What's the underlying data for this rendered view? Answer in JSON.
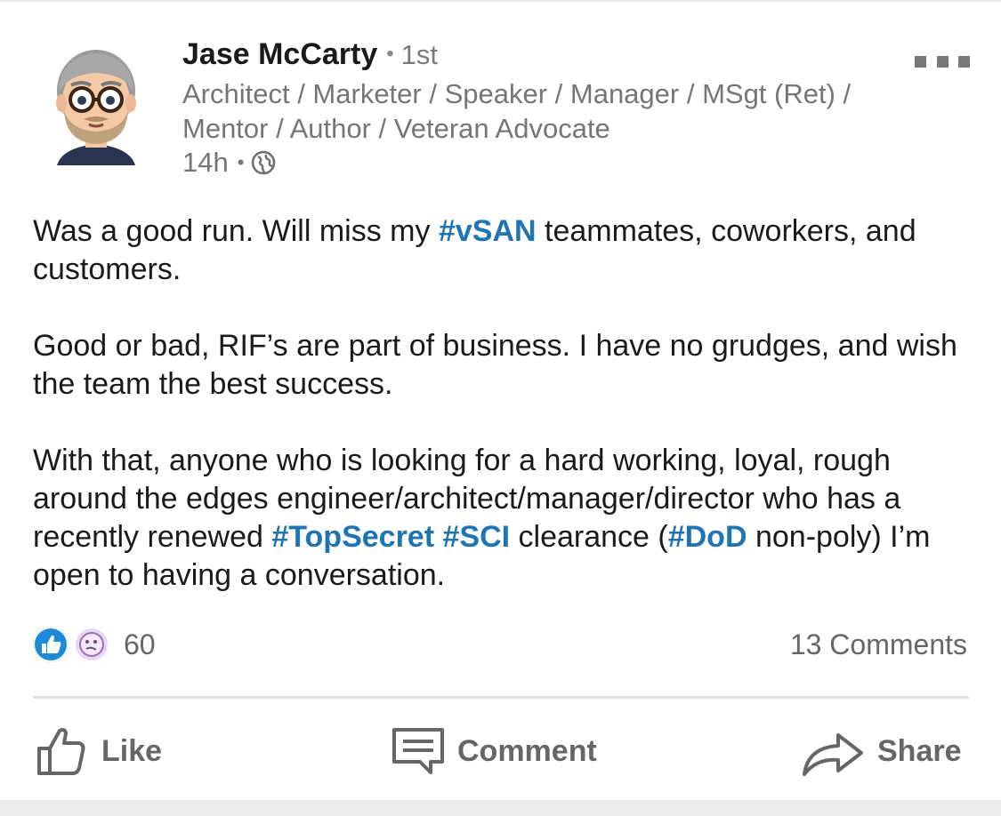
{
  "author": {
    "name": "Jase McCarty",
    "degree": "1st",
    "headline": "Architect / Marketer / Speaker / Manager / MSgt (Ret) / Mentor / Author / Veteran Advocate",
    "time": "14h",
    "visibility_icon": "globe-icon",
    "avatar_icon": "cartoon-avatar-icon"
  },
  "post": {
    "paragraphs": [
      [
        {
          "text": "Was a good run. Will miss my ",
          "tag": false
        },
        {
          "text": "#vSAN",
          "tag": true
        },
        {
          "text": " teammates, coworkers, and customers.",
          "tag": false
        }
      ],
      [
        {
          "text": "Good or bad, RIF’s are part of business. I have no grudges, and wish the team the best success.",
          "tag": false
        }
      ],
      [
        {
          "text": "With that, anyone who is looking for a hard working, loyal, rough around the edges engineer/architect/manager/director who has a recently renewed ",
          "tag": false
        },
        {
          "text": "#TopSecret",
          "tag": true
        },
        {
          "text": " ",
          "tag": false
        },
        {
          "text": "#SCI",
          "tag": true
        },
        {
          "text": " clearance (",
          "tag": false
        },
        {
          "text": "#DoD",
          "tag": true
        },
        {
          "text": " non-poly) I’m open to having a conversation.",
          "tag": false
        }
      ]
    ]
  },
  "social": {
    "reaction_count": "60",
    "comments_label": "13 Comments",
    "reaction_icons": [
      "like-reaction-icon",
      "curious-reaction-icon"
    ]
  },
  "actions": {
    "like_label": "Like",
    "comment_label": "Comment",
    "share_label": "Share"
  },
  "colors": {
    "hashtag": "#1f74b4",
    "muted_text": "#757575",
    "body_text": "#1a1a1a",
    "like_blue": "#1e8ad6"
  }
}
